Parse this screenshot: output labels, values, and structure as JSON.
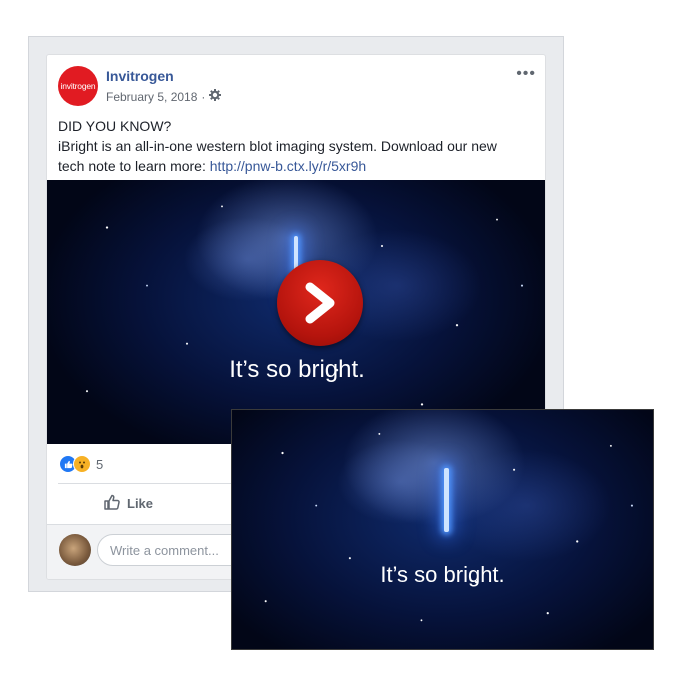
{
  "post": {
    "page_name": "Invitrogen",
    "avatar_text": "invitrogen",
    "date": "February 5, 2018",
    "separator": "·",
    "more": "•••",
    "text_lines": [
      "DID YOU KNOW?",
      "iBright is an all-in-one western blot imaging system. Download our new",
      "tech note to learn more: "
    ],
    "link": "http://pnw-b.ctx.ly/r/5xr9h",
    "video_caption": "It’s so bright.",
    "reactions_count": "5",
    "like_label": "Like",
    "comment_placeholder": "Write a comment..."
  },
  "overlay": {
    "caption": "It’s so bright."
  },
  "colors": {
    "brand_red": "#e11b22",
    "link_blue": "#385898",
    "play_red": "#c0180f",
    "like_blue": "#2078f4"
  },
  "icons": [
    "gear-icon",
    "more-icon",
    "play-icon",
    "like-reaction-icon",
    "wow-reaction-icon",
    "thumbs-up-icon"
  ]
}
